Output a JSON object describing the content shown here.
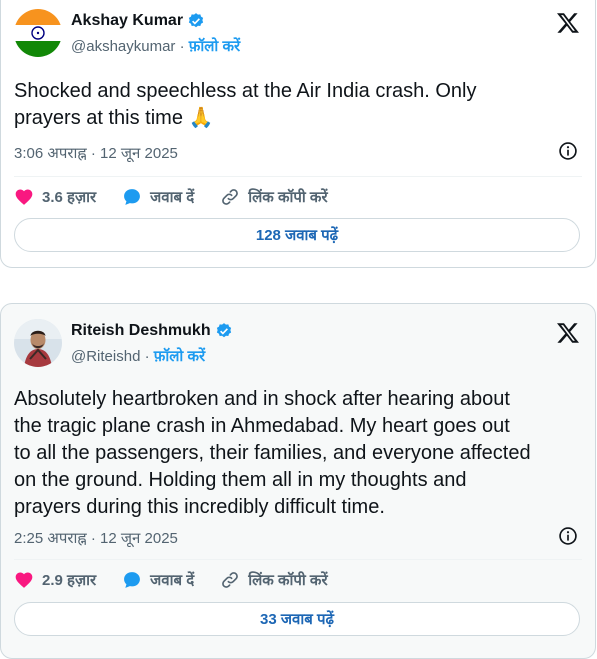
{
  "tweets": [
    {
      "name": "Akshay Kumar",
      "handle": "@akshaykumar",
      "separator": "·",
      "follow_label": "फ़ॉलो करें",
      "text_line1": "Shocked and speechless at the Air India crash. Only",
      "text_line2": "prayers at this time 🙏",
      "time": "3:06 अपराह्न",
      "dot": "·",
      "date": "12 जून 2025",
      "likes": "3.6 हज़ार",
      "reply_label": "जवाब दें",
      "copy_link_label": "लिंक कॉपी करें",
      "replies_button": "128 जवाब पढ़ें"
    },
    {
      "name": "Riteish Deshmukh",
      "handle": "@Riteishd",
      "separator": "·",
      "follow_label": "फ़ॉलो करें",
      "text_lines": [
        "Absolutely heartbroken and in shock after hearing about",
        "the tragic plane crash in Ahmedabad. My heart goes out",
        "to all the passengers, their families, and everyone affected",
        "on the ground. Holding them all in my thoughts and",
        "prayers during this incredibly difficult time."
      ],
      "time": "2:25 अपराह्न",
      "dot": "·",
      "date": "12 जून 2025",
      "likes": "2.9 हज़ार",
      "reply_label": "जवाब दें",
      "copy_link_label": "लिंक कॉपी करें",
      "replies_button": "33 जवाब पढ़ें"
    }
  ],
  "colors": {
    "accent": "#1d9bf0",
    "like": "#f91880",
    "text": "#0f1419",
    "muted": "#536471"
  },
  "icons": [
    "india-flag-avatar",
    "person-avatar",
    "verified-badge-icon",
    "x-logo-icon",
    "info-icon",
    "heart-icon",
    "reply-bubble-icon",
    "link-icon"
  ]
}
